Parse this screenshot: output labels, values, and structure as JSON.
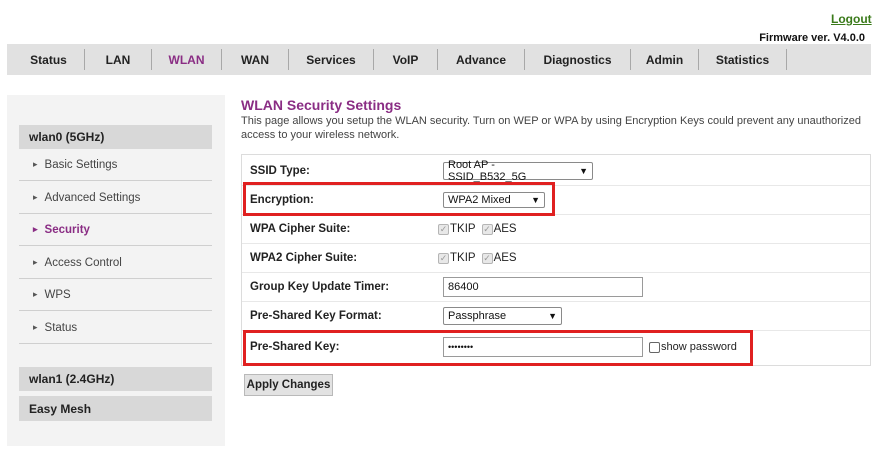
{
  "header": {
    "logout": "Logout",
    "firmware": "Firmware ver. V4.0.0"
  },
  "nav": {
    "tabs": [
      {
        "label": "Status"
      },
      {
        "label": "LAN"
      },
      {
        "label": "WLAN",
        "active": true
      },
      {
        "label": "WAN"
      },
      {
        "label": "Services"
      },
      {
        "label": "VoIP"
      },
      {
        "label": "Advance"
      },
      {
        "label": "Diagnostics"
      },
      {
        "label": "Admin"
      },
      {
        "label": "Statistics"
      }
    ]
  },
  "sidebar": {
    "group1": "wlan0 (5GHz)",
    "items": [
      "Basic Settings",
      "Advanced Settings",
      "Security",
      "Access Control",
      "WPS",
      "Status"
    ],
    "group2": "wlan1 (2.4GHz)",
    "group3": "Easy Mesh"
  },
  "page": {
    "title": "WLAN Security Settings",
    "description": "This page allows you setup the WLAN security. Turn on WEP or WPA by using Encryption Keys could prevent any unauthorized access to your wireless network."
  },
  "form": {
    "ssid_type": {
      "label": "SSID Type:",
      "value": "Root AP - SSID_B532_5G"
    },
    "encryption": {
      "label": "Encryption:",
      "value": "WPA2 Mixed"
    },
    "wpa_cipher": {
      "label": "WPA Cipher Suite:",
      "opt1": "TKIP",
      "opt2": "AES"
    },
    "wpa2_cipher": {
      "label": "WPA2 Cipher Suite:",
      "opt1": "TKIP",
      "opt2": "AES"
    },
    "group_key": {
      "label": "Group Key Update Timer:",
      "value": "86400"
    },
    "psk_format": {
      "label": "Pre-Shared Key Format:",
      "value": "Passphrase"
    },
    "psk": {
      "label": "Pre-Shared Key:",
      "value": "••••••••",
      "show_password": "show password"
    }
  },
  "apply_label": "Apply Changes",
  "colors": {
    "accent": "#8a2d84",
    "highlight": "#e02020",
    "logout": "#3a7a1a"
  }
}
